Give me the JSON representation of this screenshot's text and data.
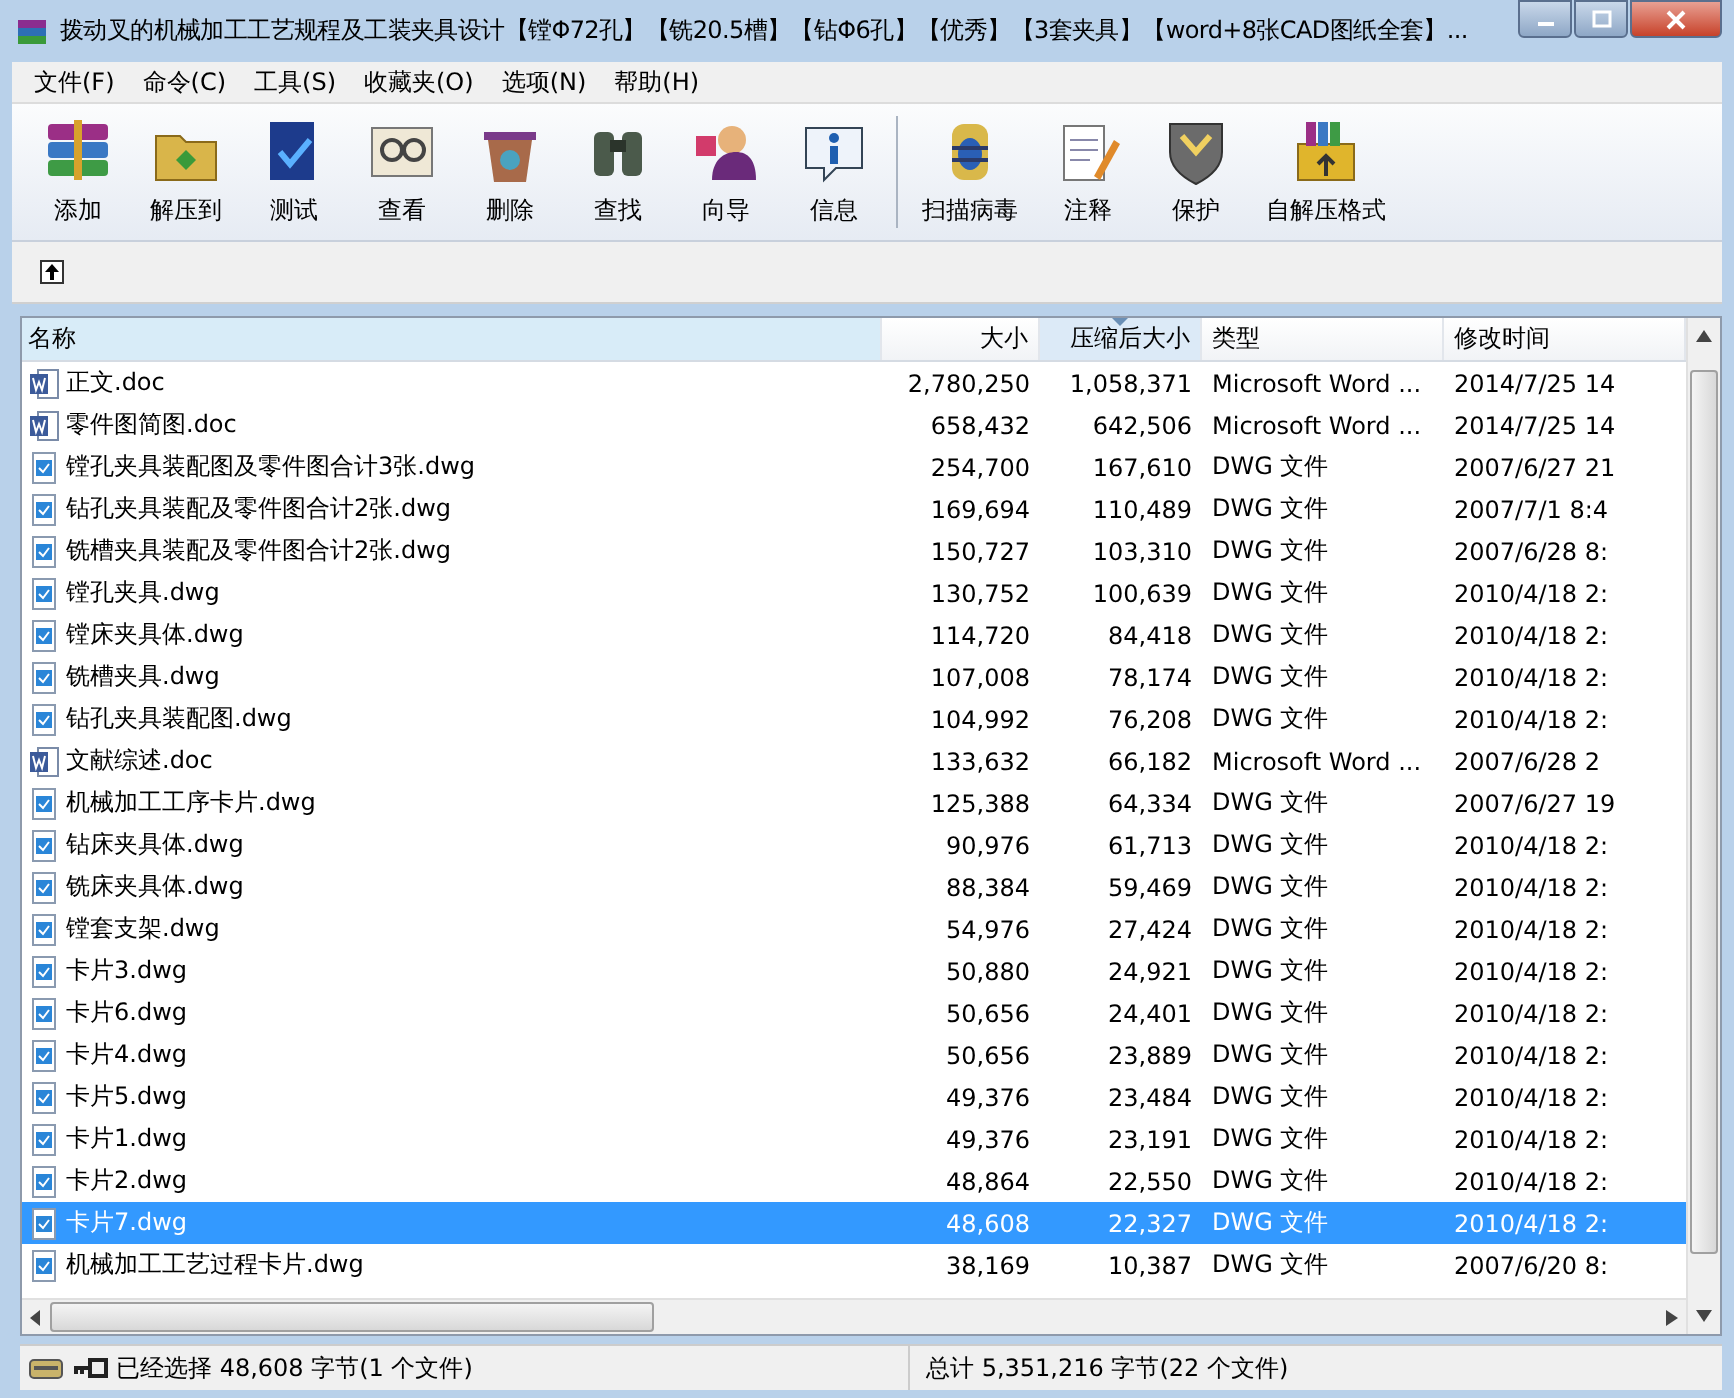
{
  "window": {
    "title": "拨动叉的机械加工工艺规程及工装夹具设计【镗Φ72孔】【铣20.5槽】【钻Φ6孔】【优秀】【3套夹具】【word+8张CAD图纸全套】..."
  },
  "menu": [
    "文件(F)",
    "命令(C)",
    "工具(S)",
    "收藏夹(O)",
    "选项(N)",
    "帮助(H)"
  ],
  "toolbar": {
    "groups": [
      [
        "添加",
        "解压到",
        "测试",
        "查看",
        "删除",
        "查找",
        "向导",
        "信息"
      ],
      [
        "扫描病毒",
        "注释",
        "保护",
        "自解压格式"
      ]
    ]
  },
  "file_list": {
    "columns": [
      {
        "label": "名称",
        "sorted": false
      },
      {
        "label": "大小",
        "sorted": false
      },
      {
        "label": "压缩后大小",
        "sorted": true
      },
      {
        "label": "类型",
        "sorted": false
      },
      {
        "label": "修改时间",
        "sorted": false
      }
    ],
    "rows": [
      {
        "kind": "doc",
        "name": "正文.doc",
        "size": "2,780,250",
        "packed": "1,058,371",
        "type": "Microsoft Word ...",
        "modified": "2014/7/25 14",
        "selected": false
      },
      {
        "kind": "doc",
        "name": "零件图简图.doc",
        "size": "658,432",
        "packed": "642,506",
        "type": "Microsoft Word ...",
        "modified": "2014/7/25 14",
        "selected": false
      },
      {
        "kind": "dwg",
        "name": "镗孔夹具装配图及零件图合计3张.dwg",
        "size": "254,700",
        "packed": "167,610",
        "type": "DWG 文件",
        "modified": "2007/6/27 21",
        "selected": false
      },
      {
        "kind": "dwg",
        "name": "钻孔夹具装配及零件图合计2张.dwg",
        "size": "169,694",
        "packed": "110,489",
        "type": "DWG 文件",
        "modified": "2007/7/1 8:4",
        "selected": false
      },
      {
        "kind": "dwg",
        "name": "铣槽夹具装配及零件图合计2张.dwg",
        "size": "150,727",
        "packed": "103,310",
        "type": "DWG 文件",
        "modified": "2007/6/28 8:",
        "selected": false
      },
      {
        "kind": "dwg",
        "name": "镗孔夹具.dwg",
        "size": "130,752",
        "packed": "100,639",
        "type": "DWG 文件",
        "modified": "2010/4/18 2:",
        "selected": false
      },
      {
        "kind": "dwg",
        "name": "镗床夹具体.dwg",
        "size": "114,720",
        "packed": "84,418",
        "type": "DWG 文件",
        "modified": "2010/4/18 2:",
        "selected": false
      },
      {
        "kind": "dwg",
        "name": "铣槽夹具.dwg",
        "size": "107,008",
        "packed": "78,174",
        "type": "DWG 文件",
        "modified": "2010/4/18 2:",
        "selected": false
      },
      {
        "kind": "dwg",
        "name": "钻孔夹具装配图.dwg",
        "size": "104,992",
        "packed": "76,208",
        "type": "DWG 文件",
        "modified": "2010/4/18 2:",
        "selected": false
      },
      {
        "kind": "doc",
        "name": "文献综述.doc",
        "size": "133,632",
        "packed": "66,182",
        "type": "Microsoft Word ...",
        "modified": "2007/6/28 2",
        "selected": false
      },
      {
        "kind": "dwg",
        "name": "机械加工工序卡片.dwg",
        "size": "125,388",
        "packed": "64,334",
        "type": "DWG 文件",
        "modified": "2007/6/27 19",
        "selected": false
      },
      {
        "kind": "dwg",
        "name": "钻床夹具体.dwg",
        "size": "90,976",
        "packed": "61,713",
        "type": "DWG 文件",
        "modified": "2010/4/18 2:",
        "selected": false
      },
      {
        "kind": "dwg",
        "name": "铣床夹具体.dwg",
        "size": "88,384",
        "packed": "59,469",
        "type": "DWG 文件",
        "modified": "2010/4/18 2:",
        "selected": false
      },
      {
        "kind": "dwg",
        "name": "镗套支架.dwg",
        "size": "54,976",
        "packed": "27,424",
        "type": "DWG 文件",
        "modified": "2010/4/18 2:",
        "selected": false
      },
      {
        "kind": "dwg",
        "name": "卡片3.dwg",
        "size": "50,880",
        "packed": "24,921",
        "type": "DWG 文件",
        "modified": "2010/4/18 2:",
        "selected": false
      },
      {
        "kind": "dwg",
        "name": "卡片6.dwg",
        "size": "50,656",
        "packed": "24,401",
        "type": "DWG 文件",
        "modified": "2010/4/18 2:",
        "selected": false
      },
      {
        "kind": "dwg",
        "name": "卡片4.dwg",
        "size": "50,656",
        "packed": "23,889",
        "type": "DWG 文件",
        "modified": "2010/4/18 2:",
        "selected": false
      },
      {
        "kind": "dwg",
        "name": "卡片5.dwg",
        "size": "49,376",
        "packed": "23,484",
        "type": "DWG 文件",
        "modified": "2010/4/18 2:",
        "selected": false
      },
      {
        "kind": "dwg",
        "name": "卡片1.dwg",
        "size": "49,376",
        "packed": "23,191",
        "type": "DWG 文件",
        "modified": "2010/4/18 2:",
        "selected": false
      },
      {
        "kind": "dwg",
        "name": "卡片2.dwg",
        "size": "48,864",
        "packed": "22,550",
        "type": "DWG 文件",
        "modified": "2010/4/18 2:",
        "selected": false
      },
      {
        "kind": "dwg",
        "name": "卡片7.dwg",
        "size": "48,608",
        "packed": "22,327",
        "type": "DWG 文件",
        "modified": "2010/4/18 2:",
        "selected": true
      },
      {
        "kind": "dwg",
        "name": "机械加工工艺过程卡片.dwg",
        "size": "38,169",
        "packed": "10,387",
        "type": "DWG 文件",
        "modified": "2007/6/20 8:",
        "selected": false
      }
    ]
  },
  "status_bar": {
    "selection": "已经选择 48,608 字节(1 个文件)",
    "total": "总计 5,351,216 字节(22 个文件)"
  }
}
